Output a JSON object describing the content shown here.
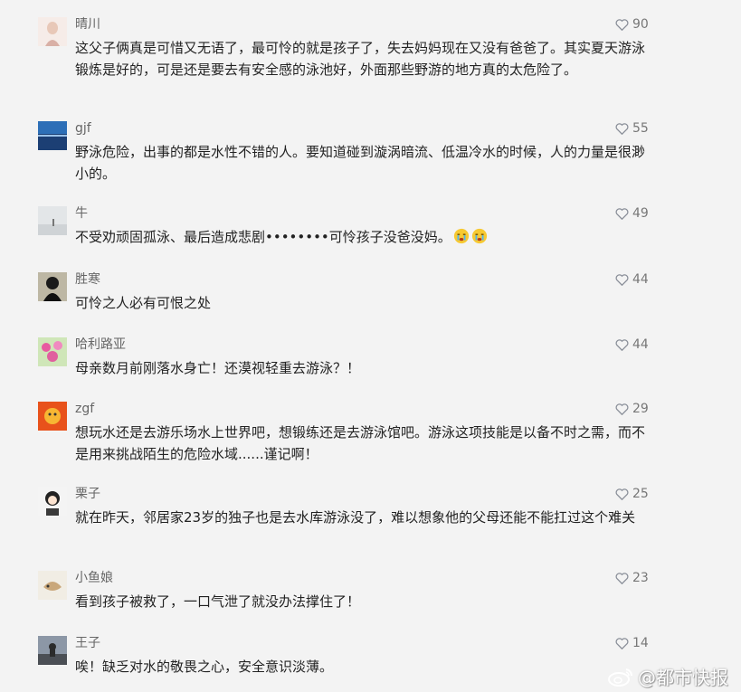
{
  "comments": [
    {
      "user": "晴川",
      "likes": "90",
      "text": "这父子俩真是可惜又无语了，最可怜的就是孩子了，失去妈妈现在又没有爸爸了。其实夏天游泳锻炼是好的，可是还是要去有安全感的泳池好，外面那些野游的地方真的太危险了。"
    },
    {
      "user": "gjf",
      "likes": "55",
      "text": "野泳危险，出事的都是水性不错的人。要知道碰到漩涡暗流、低温冷水的时候，人的力量是很渺小的。"
    },
    {
      "user": "牛",
      "likes": "49",
      "text": "不受劝顽固孤泳、最后造成悲剧••••••••可怜孩子没爸没妈。",
      "emojis": [
        "crying-face-icon",
        "crying-face-icon"
      ]
    },
    {
      "user": "胜寒",
      "likes": "44",
      "text": "可怜之人必有可恨之处"
    },
    {
      "user": "哈利路亚",
      "likes": "44",
      "text": "母亲数月前刚落水身亡！还漠视轻重去游泳？！"
    },
    {
      "user": "zgf",
      "likes": "29",
      "text": "想玩水还是去游乐场水上世界吧，想锻练还是去游泳馆吧。游泳这项技能是以备不时之需，而不是用来挑战陌生的危险水域......谨记啊！"
    },
    {
      "user": "栗子",
      "likes": "25",
      "text": "就在昨天，邻居家23岁的独子也是去水库游泳没了，难以想象他的父母还能不能扛过这个难关"
    },
    {
      "user": "小鱼娘",
      "likes": "23",
      "text": "看到孩子被救了，一口气泄了就没办法撑住了！"
    },
    {
      "user": "王子",
      "likes": "14",
      "text": "唉！缺乏对水的敬畏之心，安全意识淡薄。"
    }
  ],
  "watermark": "@都市快报",
  "colors": {
    "background": "#f3f3f3",
    "username": "#666666",
    "text": "#222222",
    "likes": "#777777"
  }
}
